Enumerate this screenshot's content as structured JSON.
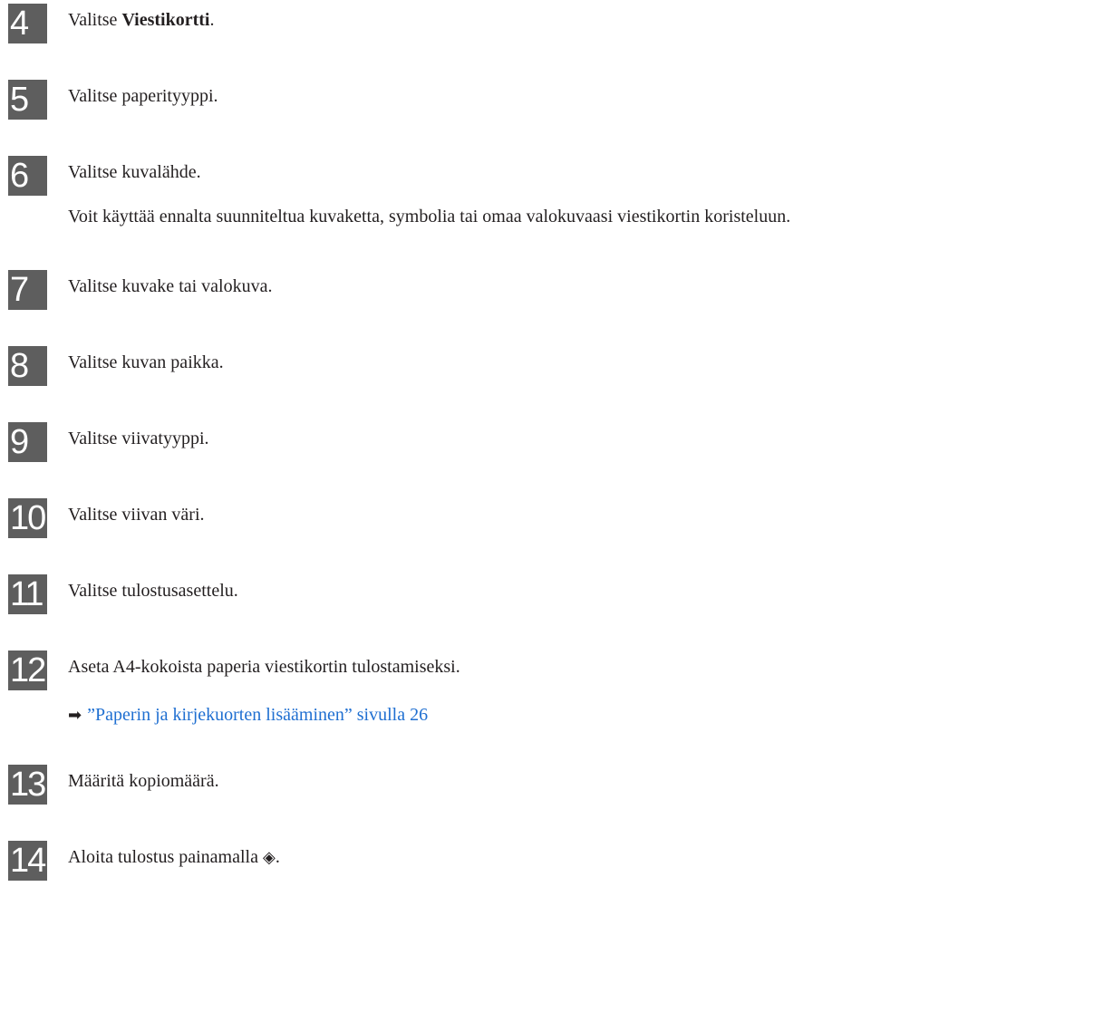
{
  "steps": [
    {
      "num": "4",
      "before": "Valitse ",
      "bold": "Viestikortti",
      "after": "."
    },
    {
      "num": "5",
      "text": "Valitse paperityyppi."
    },
    {
      "num": "6",
      "text": "Valitse kuvalähde.",
      "note": "Voit käyttää ennalta suunniteltua kuvaketta, symbolia tai omaa valokuvaasi viestikortin koristeluun."
    },
    {
      "num": "7",
      "text": "Valitse kuvake tai valokuva."
    },
    {
      "num": "8",
      "text": "Valitse kuvan paikka."
    },
    {
      "num": "9",
      "text": "Valitse viivatyyppi."
    },
    {
      "num": "10",
      "text": "Valitse viivan väri."
    },
    {
      "num": "11",
      "text": "Valitse tulostusasettelu."
    },
    {
      "num": "12",
      "text": "Aseta A4-kokoista paperia viestikortin tulostamiseksi.",
      "xref_arrow": "➡",
      "xref_text": "”Paperin ja kirjekuorten lisääminen” sivulla 26"
    },
    {
      "num": "13",
      "text": "Määritä kopiomäärä."
    },
    {
      "num": "14",
      "text": "Aloita tulostus painamalla ",
      "glyph": "◈",
      "after": "."
    }
  ]
}
